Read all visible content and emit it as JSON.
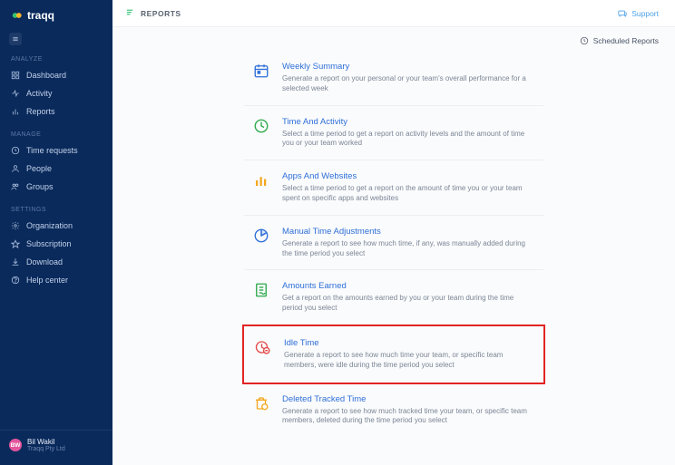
{
  "brand": "traqq",
  "topbar": {
    "title": "REPORTS",
    "support": "Support",
    "scheduled": "Scheduled Reports"
  },
  "sidebar": {
    "sections": [
      {
        "label": "ANALYZE",
        "items": [
          {
            "label": "Dashboard"
          },
          {
            "label": "Activity"
          },
          {
            "label": "Reports"
          }
        ]
      },
      {
        "label": "MANAGE",
        "items": [
          {
            "label": "Time requests"
          },
          {
            "label": "People"
          },
          {
            "label": "Groups"
          }
        ]
      },
      {
        "label": "SETTINGS",
        "items": [
          {
            "label": "Organization"
          },
          {
            "label": "Subscription"
          },
          {
            "label": "Download"
          },
          {
            "label": "Help center"
          }
        ]
      }
    ]
  },
  "user": {
    "name": "Bil Wakil",
    "company": "Traqq Pty Ltd",
    "initials": "BW"
  },
  "reports": [
    {
      "title": "Weekly Summary",
      "desc": "Generate a report on your personal or your team's overall performance for a selected week",
      "color": "#2e6fd8",
      "icon": "calendar"
    },
    {
      "title": "Time And Activity",
      "desc": "Select a time period to get a report on activity levels and the amount of time you or your team worked",
      "color": "#2ba84a",
      "icon": "clock"
    },
    {
      "title": "Apps And Websites",
      "desc": "Select a time period to get a report on the amount of time you or your team spent on specific apps and websites",
      "color": "#f4a71f",
      "icon": "bars"
    },
    {
      "title": "Manual Time Adjustments",
      "desc": "Generate a report to see how much time, if any, was manually added during the time period you select",
      "color": "#2e6fd8",
      "icon": "pie"
    },
    {
      "title": "Amounts Earned",
      "desc": "Get a report on the amounts earned by you or your team during the time period you select",
      "color": "#2ba84a",
      "icon": "receipt"
    },
    {
      "title": "Idle Time",
      "desc": "Generate a report to see how much time your team, or specific team members, were idle during the time period you select",
      "color": "#e34747",
      "icon": "idle",
      "highlight": true
    },
    {
      "title": "Deleted Tracked Time",
      "desc": "Generate a report to see how much tracked time your team, or specific team members, deleted during the time period you select",
      "color": "#f4a71f",
      "icon": "trash"
    }
  ]
}
